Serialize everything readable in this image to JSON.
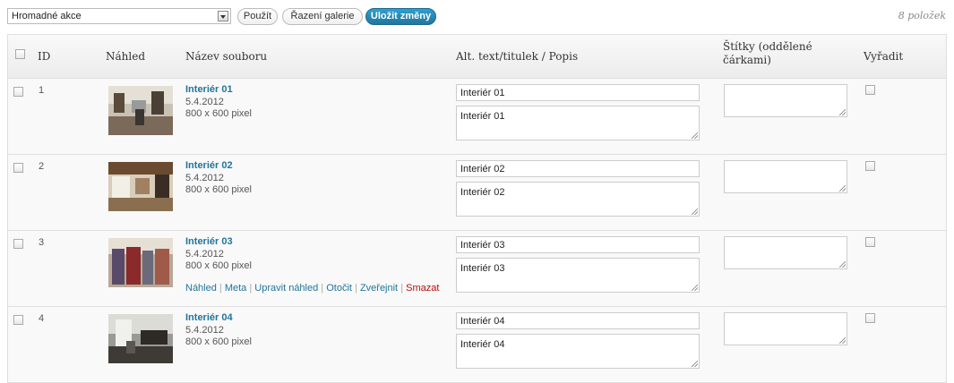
{
  "toolbar": {
    "bulk_actions": "Hromadné akce",
    "apply": "Použít",
    "sort": "Řazení galerie",
    "save": "Uložit změny",
    "count": "8 položek"
  },
  "table": {
    "headers": {
      "id": "ID",
      "thumb": "Náhled",
      "file": "Název souboru",
      "alt": "Alt. text/titulek / Popis",
      "tags": "Štítky (oddělené čárkami)",
      "exclude": "Vyřadit"
    },
    "rows": [
      {
        "id": "1",
        "name": "Interiér 01",
        "date": "5.4.2012",
        "dims": "800 x 600 pixel",
        "alt": "Interiér 01",
        "desc": "Interiér 01"
      },
      {
        "id": "2",
        "name": "Interiér 02",
        "date": "5.4.2012",
        "dims": "800 x 600 pixel",
        "alt": "Interiér 02",
        "desc": "Interiér 02"
      },
      {
        "id": "3",
        "name": "Interiér 03",
        "date": "5.4.2012",
        "dims": "800 x 600 pixel",
        "alt": "Interiér 03",
        "desc": "Interiér 03",
        "actions": {
          "preview": "Náhled",
          "meta": "Meta",
          "edit_thumb": "Upravit náhled",
          "rotate": "Otočit",
          "publish": "Zveřejnit",
          "delete": "Smazat"
        }
      },
      {
        "id": "4",
        "name": "Interiér 04",
        "date": "5.4.2012",
        "dims": "800 x 600 pixel",
        "alt": "Interiér 04",
        "desc": "Interiér 04"
      }
    ]
  },
  "colors": {
    "link": "#21759b",
    "delete": "#bc0b0b",
    "primary_button": "#21759b"
  }
}
